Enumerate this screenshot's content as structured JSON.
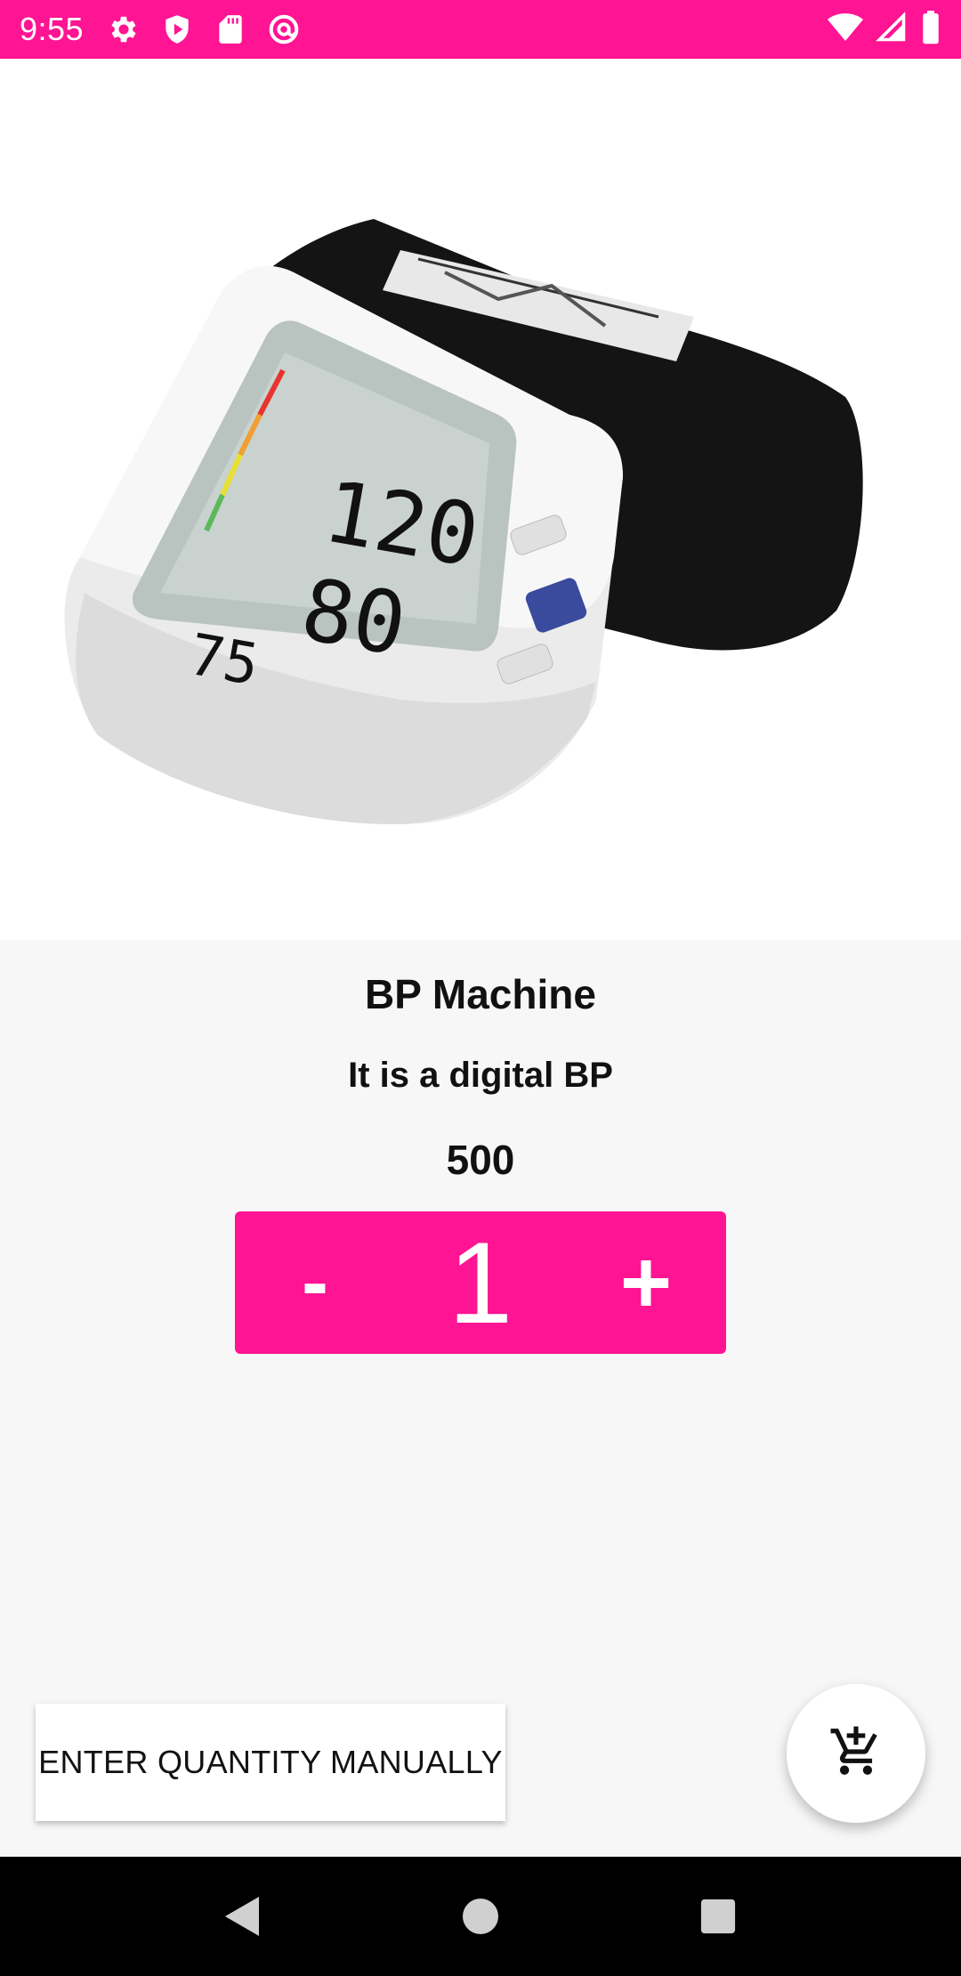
{
  "status_bar": {
    "time": "9:55",
    "background": "#ff1493",
    "left_icons": [
      "settings-icon",
      "shield-play-icon",
      "sd-card-icon",
      "at-sync-icon"
    ],
    "right_icons": [
      "wifi-icon",
      "signal-icon",
      "battery-icon"
    ]
  },
  "product": {
    "image_icon": "blood-pressure-monitor-image",
    "image_readings": {
      "sys": "120",
      "dia": "80",
      "pulse": "75"
    },
    "name": "BP Machine",
    "description": "It is a digital BP",
    "price": "500"
  },
  "stepper": {
    "minus_label": "-",
    "quantity": "1",
    "plus_label": "+",
    "color": "#ff1493"
  },
  "actions": {
    "manual_quantity_label": "ENTER QUANTITY MANUALLY",
    "cart_icon": "add-shopping-cart-icon"
  },
  "nav_bar": {
    "items": [
      "back-icon",
      "home-icon",
      "recents-icon"
    ]
  }
}
